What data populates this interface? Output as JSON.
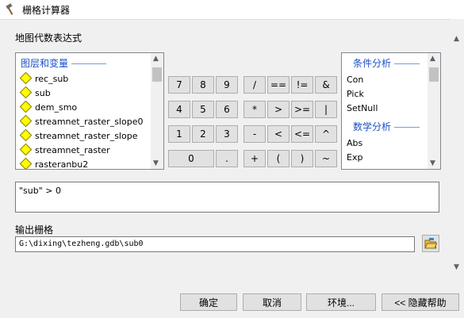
{
  "window": {
    "title": "栅格计算器"
  },
  "expression_section": {
    "label": "地图代数表达式"
  },
  "layers": {
    "group_label": "图层和变量",
    "items": [
      "rec_sub",
      "sub",
      "dem_smo",
      "streamnet_raster_slope0",
      "streamnet_raster_slope",
      "streamnet_raster",
      "rasteranbu2"
    ]
  },
  "calculator": {
    "rows": [
      [
        "7",
        "8",
        "9",
        "/",
        "==",
        "!=",
        "&"
      ],
      [
        "4",
        "5",
        "6",
        "*",
        ">",
        ">=",
        "|"
      ],
      [
        "1",
        "2",
        "3",
        "-",
        "<",
        "<=",
        "^"
      ],
      [
        "0",
        ".",
        "+",
        "(",
        ")",
        "~"
      ]
    ]
  },
  "functions": {
    "group1_label": "条件分析",
    "group1_items": [
      "Con",
      "Pick",
      "SetNull"
    ],
    "group2_label": "数学分析",
    "group2_items": [
      "Abs",
      "Exp"
    ]
  },
  "expression": {
    "value": "\"sub\" > 0"
  },
  "output": {
    "label": "输出栅格",
    "path": "G:\\dixing\\tezheng.gdb\\sub0"
  },
  "footer": {
    "ok": "确定",
    "cancel": "取消",
    "env": "环境...",
    "help": "<< 隐藏帮助"
  }
}
